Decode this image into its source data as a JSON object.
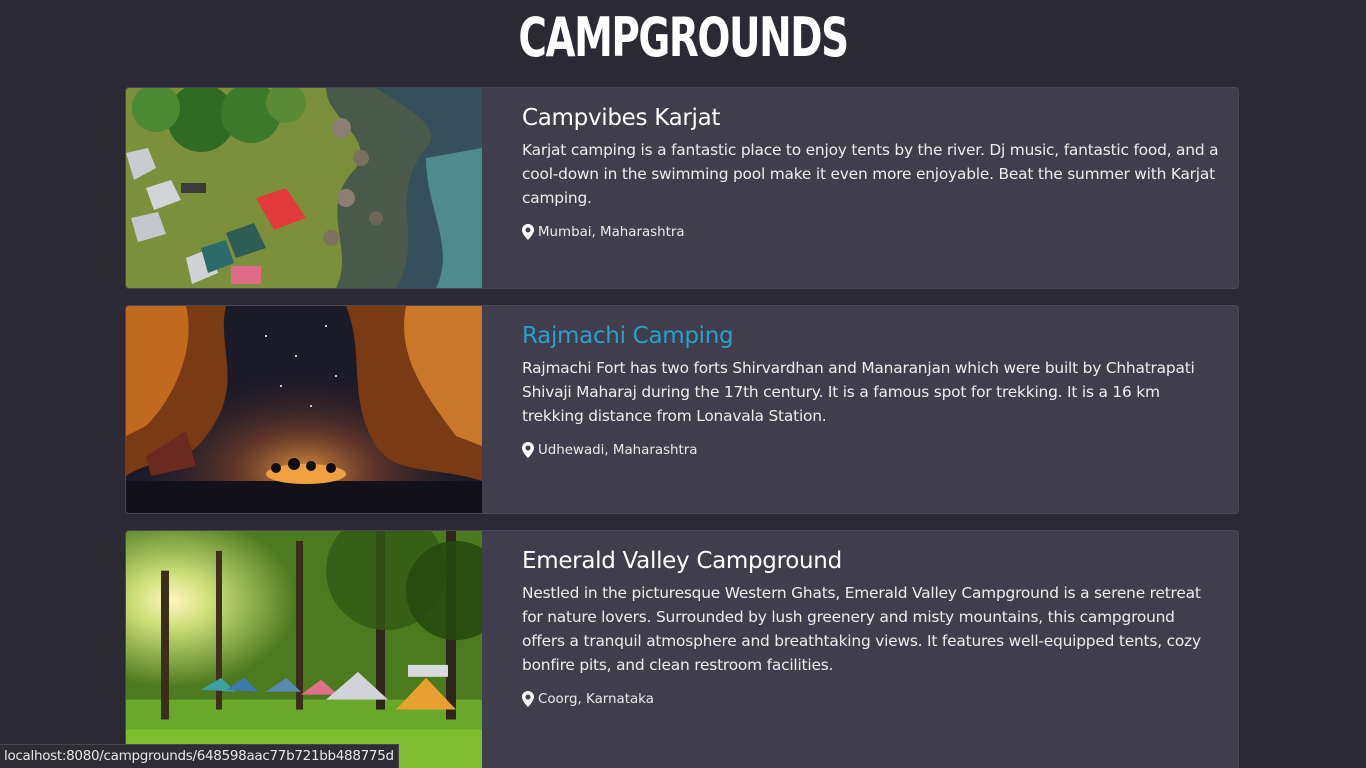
{
  "page": {
    "title": "CAMPGROUNDS"
  },
  "campgrounds": [
    {
      "title": "Campvibes Karjat",
      "description": "Karjat camping is a fantastic place to enjoy tents by the river. Dj music, fantastic food, and a cool-down in the swimming pool make it even more enjoyable. Beat the summer with Karjat camping.",
      "location": "Mumbai, Maharashtra",
      "image": "aerial-riverside-tents"
    },
    {
      "title": "Rajmachi Camping",
      "description": "Rajmachi Fort has two forts Shirvardhan and Manaranjan which were built by Chhatrapati Shivaji Maharaj during the 17th century. It is a famous spot for trekking. It is a 16 km trekking distance from Lonavala Station.",
      "location": "Udhewadi, Maharashtra",
      "image": "night-bonfire-milky-way"
    },
    {
      "title": "Emerald Valley Campground",
      "description": "Nestled in the picturesque Western Ghats, Emerald Valley Campground is a serene retreat for nature lovers. Surrounded by lush greenery and misty mountains, this campground offers a tranquil atmosphere and breathtaking views. It features well-equipped tents, cozy bonfire pits, and clean restroom facilities.",
      "location": "Coorg, Karnataka",
      "image": "forest-tents-sunlight"
    }
  ],
  "statusbar": {
    "url": "localhost:8080/campgrounds/648598aac77b721bb488775d"
  },
  "colors": {
    "background": "#2b2a34",
    "card": "#403e4c",
    "link": "#2aa0c9"
  }
}
